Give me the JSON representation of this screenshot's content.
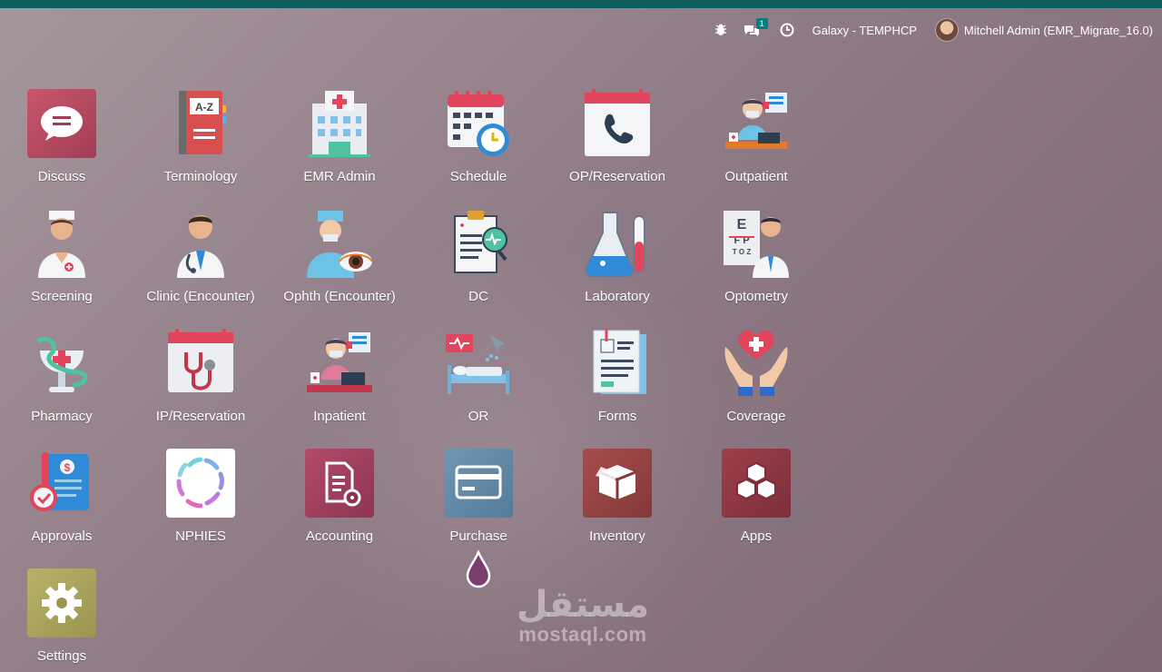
{
  "topbar": {
    "accent_color": "#0f5e5e",
    "debug_icon": "bug-icon",
    "messages_icon": "chat-icon",
    "messages_count": "1",
    "activity_icon": "clock-icon",
    "company": "Galaxy - TEMPHCP",
    "user": "Mitchell Admin (EMR_Migrate_16.0)"
  },
  "apps": [
    {
      "label": "Discuss",
      "icon": "chat-bubble-icon"
    },
    {
      "label": "Terminology",
      "icon": "a-z-book-icon"
    },
    {
      "label": "EMR Admin",
      "icon": "hospital-building-icon"
    },
    {
      "label": "Schedule",
      "icon": "calendar-clock-icon"
    },
    {
      "label": "OP/Reservation",
      "icon": "calendar-phone-icon"
    },
    {
      "label": "Outpatient",
      "icon": "nurse-desk-icon"
    },
    {
      "label": "Screening",
      "icon": "nurse-icon"
    },
    {
      "label": "Clinic (Encounter)",
      "icon": "doctor-stethoscope-icon"
    },
    {
      "label": "Ophth (Encounter)",
      "icon": "eye-doctor-icon"
    },
    {
      "label": "DC",
      "icon": "clipboard-ecg-icon"
    },
    {
      "label": "Laboratory",
      "icon": "flask-icon"
    },
    {
      "label": "Optometry",
      "icon": "eye-chart-icon"
    },
    {
      "label": "Pharmacy",
      "icon": "bowl-of-hygieia-icon"
    },
    {
      "label": "IP/Reservation",
      "icon": "calendar-stethoscope-icon"
    },
    {
      "label": "Inpatient",
      "icon": "nurse-desk-icon"
    },
    {
      "label": "OR",
      "icon": "hospital-bed-icon"
    },
    {
      "label": "Forms",
      "icon": "documents-icon"
    },
    {
      "label": "Coverage",
      "icon": "hands-heart-icon"
    },
    {
      "label": "Approvals",
      "icon": "approved-document-icon"
    },
    {
      "label": "NPHIES",
      "icon": "nphies-logo-icon"
    },
    {
      "label": "Accounting",
      "icon": "document-gear-icon"
    },
    {
      "label": "Purchase",
      "icon": "credit-card-icon"
    },
    {
      "label": "Inventory",
      "icon": "box-icon"
    },
    {
      "label": "Apps",
      "icon": "cubes-icon"
    },
    {
      "label": "Settings",
      "icon": "gear-icon"
    }
  ],
  "watermark": {
    "arabic": "مستقل",
    "latin": "mostaql.com"
  }
}
